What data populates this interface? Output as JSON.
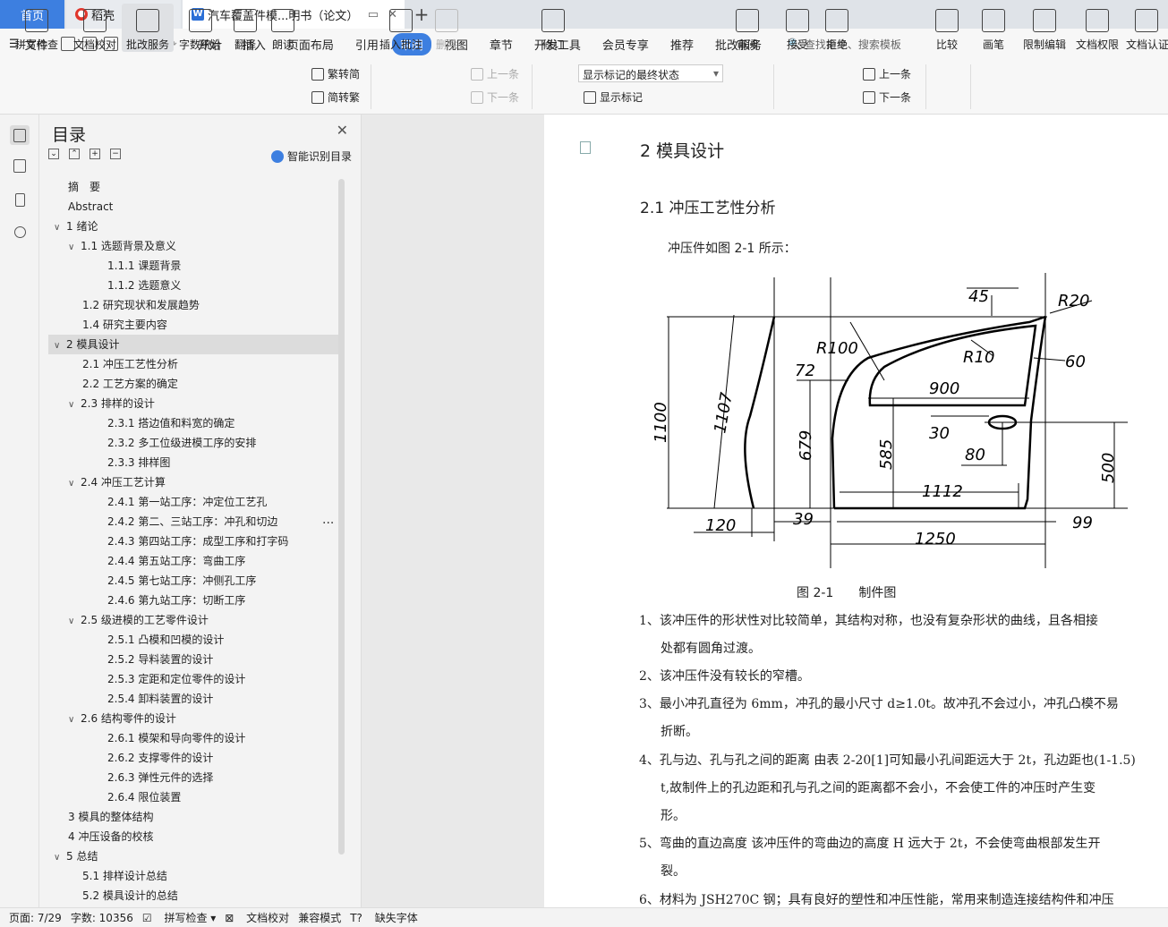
{
  "tabs": {
    "home": "首页",
    "daoke": "稻壳",
    "doc": "汽车覆盖件模...明书（论文）",
    "add": "+"
  },
  "menu": {
    "file": "文件",
    "items": [
      "开始",
      "插入",
      "页面布局",
      "引用",
      "审阅",
      "视图",
      "章节",
      "开发工具",
      "会员专享",
      "推荐",
      "批改服务"
    ],
    "active_index": 4,
    "search": "查找命令、搜索模板"
  },
  "ribbon": {
    "spell_check": "拼写检查",
    "doc_proof": "文档校对",
    "correct_service": "批改服务",
    "word_count": "字数统计",
    "translate": "翻译",
    "read_aloud": "朗读",
    "trad_to_simp": "繁转简",
    "simp_to_trad": "简转繁",
    "insert_comment": "插入批注",
    "delete": "删除",
    "prev": "上一条",
    "next": "下一条",
    "revise": "修订",
    "markup_state": "显示标记的最终状态",
    "show_markup": "显示标记",
    "review": "审阅",
    "accept": "接受",
    "reject": "拒绝",
    "prev2": "上一条",
    "next2": "下一条",
    "compare": "比较",
    "pen": "画笔",
    "restrict_edit": "限制编辑",
    "doc_permission": "文档权限",
    "doc_certify": "文档认证"
  },
  "toc": {
    "title": "目录",
    "smart": "智能识别目录",
    "items": [
      {
        "text": "摘　要",
        "level": 1,
        "caret": ""
      },
      {
        "text": "Abstract",
        "level": 1,
        "caret": ""
      },
      {
        "text": "1  绪论",
        "level": 1,
        "caret": "v"
      },
      {
        "text": "1.1 选题背景及意义",
        "level": 2,
        "caret": "v"
      },
      {
        "text": "1.1.1  课题背景",
        "level": 3,
        "caret": ""
      },
      {
        "text": "1.1.2  选题意义",
        "level": 3,
        "caret": ""
      },
      {
        "text": "1.2  研究现状和发展趋势",
        "level": 2,
        "caret": ""
      },
      {
        "text": "1.4  研究主要内容",
        "level": 2,
        "caret": ""
      },
      {
        "text": "2  模具设计",
        "level": 1,
        "caret": "v"
      },
      {
        "text": "2.1  冲压工艺性分析",
        "level": 2,
        "caret": ""
      },
      {
        "text": "2.2  工艺方案的确定",
        "level": 2,
        "caret": ""
      },
      {
        "text": "2.3  排样的设计",
        "level": 2,
        "caret": "v"
      },
      {
        "text": "2.3.1  搭边值和料宽的确定",
        "level": 3,
        "caret": ""
      },
      {
        "text": "2.3.2  多工位级进模工序的安排",
        "level": 3,
        "caret": ""
      },
      {
        "text": "2.3.3  排样图",
        "level": 3,
        "caret": ""
      },
      {
        "text": "2.4  冲压工艺计算",
        "level": 2,
        "caret": "v"
      },
      {
        "text": "2.4.1 第一站工序：冲定位工艺孔",
        "level": 3,
        "caret": ""
      },
      {
        "text": "2.4.2 第二、三站工序：冲孔和切边",
        "level": 3,
        "caret": ""
      },
      {
        "text": "2.4.3 第四站工序：成型工序和打字码",
        "level": 3,
        "caret": ""
      },
      {
        "text": "2.4.4 第五站工序：弯曲工序",
        "level": 3,
        "caret": ""
      },
      {
        "text": "2.4.5 第七站工序：冲侧孔工序",
        "level": 3,
        "caret": ""
      },
      {
        "text": "2.4.6 第九站工序：切断工序",
        "level": 3,
        "caret": ""
      },
      {
        "text": "2.5  级进模的工艺零件设计",
        "level": 2,
        "caret": "v"
      },
      {
        "text": "2.5.1  凸模和凹模的设计",
        "level": 3,
        "caret": ""
      },
      {
        "text": "2.5.2  导料装置的设计",
        "level": 3,
        "caret": ""
      },
      {
        "text": "2.5.3  定距和定位零件的设计",
        "level": 3,
        "caret": ""
      },
      {
        "text": "2.5.4  卸料装置的设计",
        "level": 3,
        "caret": ""
      },
      {
        "text": "2.6  结构零件的设计",
        "level": 2,
        "caret": "v"
      },
      {
        "text": "2.6.1  模架和导向零件的设计",
        "level": 3,
        "caret": ""
      },
      {
        "text": "2.6.2  支撑零件的设计",
        "level": 3,
        "caret": ""
      },
      {
        "text": "2.6.3  弹性元件的选择",
        "level": 3,
        "caret": ""
      },
      {
        "text": "2.6.4  限位装置",
        "level": 3,
        "caret": ""
      },
      {
        "text": "3  模具的整体结构",
        "level": 1,
        "caret": ""
      },
      {
        "text": "4  冲压设备的校核",
        "level": 1,
        "caret": ""
      },
      {
        "text": "5  总结",
        "level": 1,
        "caret": "v"
      },
      {
        "text": "5.1  排样设计总结",
        "level": 2,
        "caret": ""
      },
      {
        "text": "5.2  模具设计的总结",
        "level": 2,
        "caret": ""
      }
    ],
    "selected_index": 8
  },
  "doc": {
    "h1": "2  模具设计",
    "h2": "2.1  冲压工艺性分析",
    "intro": "冲压件如图 2-1 所示：",
    "caption": "图 2-1　　制件图",
    "dims": [
      "45",
      "R20",
      "R100",
      "72",
      "R10",
      "60",
      "900",
      "30",
      "80",
      "1100",
      "1107",
      "679",
      "585",
      "500",
      "1112",
      "120",
      "39",
      "99",
      "1250"
    ],
    "lines": [
      "1、该冲压件的形状性对比较简单，其结构对称，也没有复杂形状的曲线，且各相接",
      "处都有圆角过渡。",
      "2、该冲压件没有较长的窄槽。",
      "3、最小冲孔直径为 6mm，冲孔的最小尺寸 d≥1.0t。故冲孔不会过小，冲孔凸模不易",
      "折断。",
      "4、孔与边、孔与孔之间的距离  由表 2-20[1]可知最小孔间距远大于 2t，孔边距也(1-1.5)",
      "t,故制件上的孔边距和孔与孔之间的距离都不会小，不会使工件的冲压时产生变",
      "形。",
      "5、弯曲的直边高度    该冲压件的弯曲边的高度 H 远大于 2t，不会使弯曲根部发生开",
      "裂。",
      "6、材料为 JSH270C 钢；具有良好的塑性和冲压性能，常用来制造连接结构件和冲压"
    ]
  },
  "status": {
    "page": "页面: 7/29",
    "words": "字数: 10356",
    "spell": "拼写检查",
    "proof": "文档校对",
    "compat": "兼容模式",
    "missing_font": "缺失字体"
  }
}
